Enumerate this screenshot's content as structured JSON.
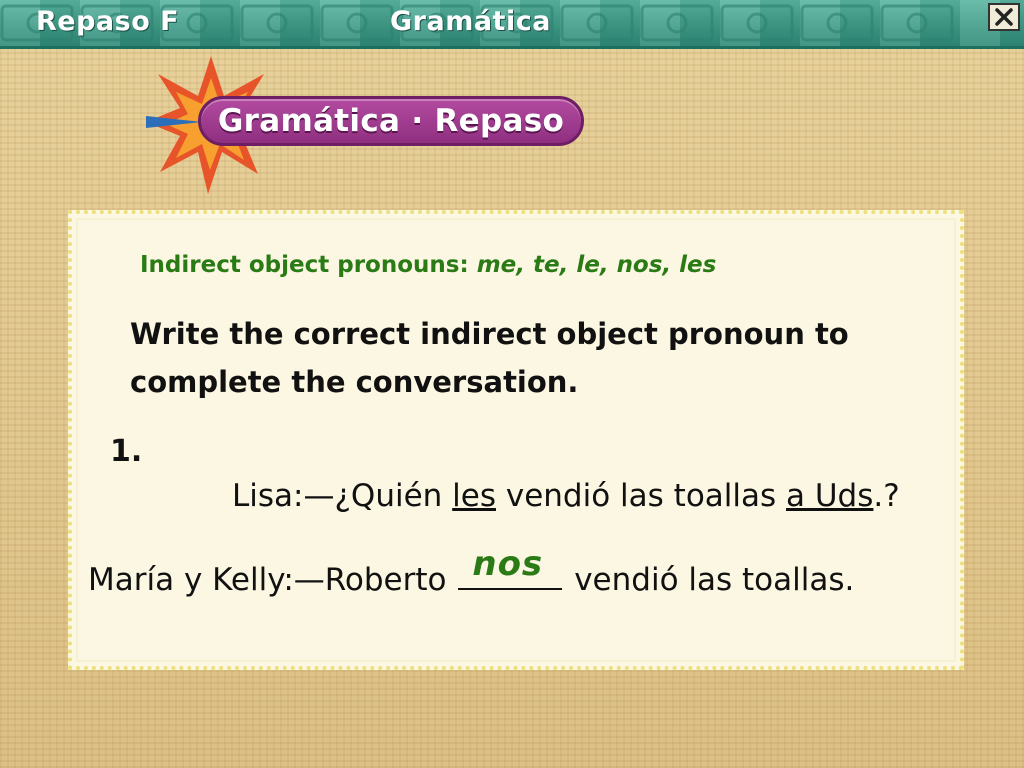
{
  "header": {
    "left_title": "Repaso F",
    "right_title": "Gramática",
    "close_icon": "close-icon"
  },
  "logo": {
    "text": "Gramática · Repaso",
    "icon": "starburst-icon",
    "colors": {
      "pill": "#a03d92",
      "star_outer": "#e8542a",
      "star_inner": "#f7a030",
      "star_blue": "#2c6fb8"
    }
  },
  "card": {
    "subtitle_label": "Indirect object pronouns:",
    "subtitle_pronouns": "me, te, le, nos, les",
    "instruction": "Write the correct indirect object pronoun to complete the conversation.",
    "item_number": "1.",
    "line1": {
      "speaker": "Lisa:—¿Quién ",
      "pronoun": "les",
      "middle": " vendió las toallas ",
      "phrase": "a Uds",
      "end": ".?"
    },
    "line2": {
      "speaker": "María y Kelly:—Roberto ",
      "answer": "nos",
      "end": " vendió las toallas."
    }
  },
  "colors": {
    "banner": "#3f9c88",
    "accent_green": "#2a7a16",
    "card_bg": "#fbf7e2"
  }
}
